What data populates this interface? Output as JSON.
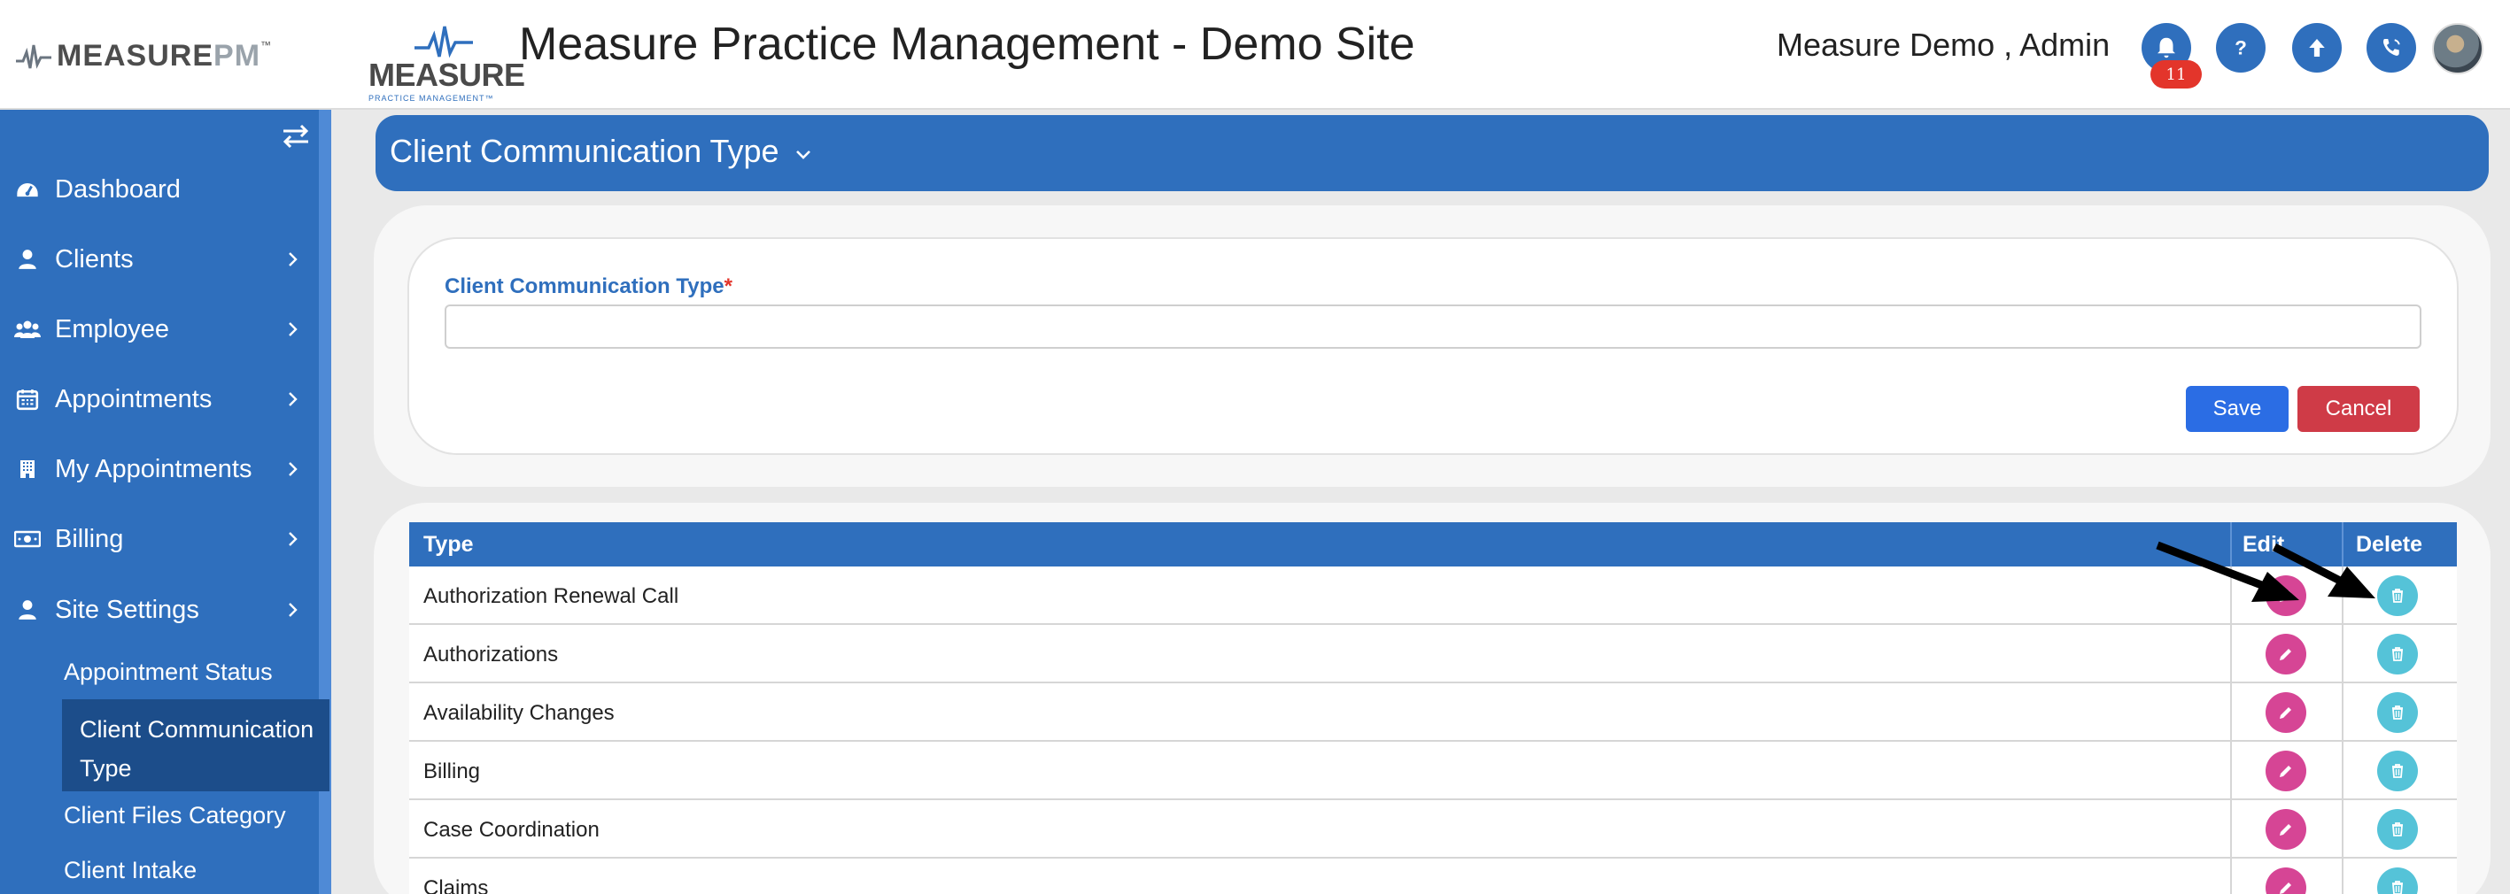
{
  "header": {
    "brand_left": "MEASURE",
    "brand_left_pm": "PM",
    "brand_left_tm": "™",
    "logo_name": "MEASURE",
    "logo_sub": "PRACTICE MANAGEMENT™",
    "app_title": "Measure Practice Management - Demo Site",
    "user_name": "Measure Demo , Admin",
    "notification_count": "11",
    "icons": [
      "bell-icon",
      "help-icon",
      "upload-icon",
      "phone-icon"
    ],
    "accent_color": "#2f6fbd"
  },
  "sidebar": {
    "items": [
      {
        "label": "Dashboard",
        "icon": "dashboard-icon"
      },
      {
        "label": "Clients",
        "icon": "user-icon"
      },
      {
        "label": "Employee",
        "icon": "users-icon"
      },
      {
        "label": "Appointments",
        "icon": "calendar-icon"
      },
      {
        "label": "My Appointments",
        "icon": "building-icon"
      },
      {
        "label": "Billing",
        "icon": "money-icon"
      },
      {
        "label": "Site Settings",
        "icon": "user-icon"
      }
    ],
    "sub_items": [
      {
        "label": "Appointment Status"
      },
      {
        "label": "Client Communication Type",
        "active": true
      },
      {
        "label": "Client Files Category"
      },
      {
        "label": "Client Intake"
      }
    ]
  },
  "page": {
    "title": "Client Communication Type"
  },
  "form": {
    "label": "Client Communication Type",
    "required_mark": "*",
    "value": "",
    "save_label": "Save",
    "cancel_label": "Cancel"
  },
  "table": {
    "headers": {
      "type": "Type",
      "edit": "Edit",
      "delete": "Delete"
    },
    "rows": [
      {
        "type": "Authorization Renewal Call"
      },
      {
        "type": "Authorizations"
      },
      {
        "type": "Availability Changes"
      },
      {
        "type": "Billing"
      },
      {
        "type": "Case Coordination"
      },
      {
        "type": "Claims"
      }
    ]
  }
}
